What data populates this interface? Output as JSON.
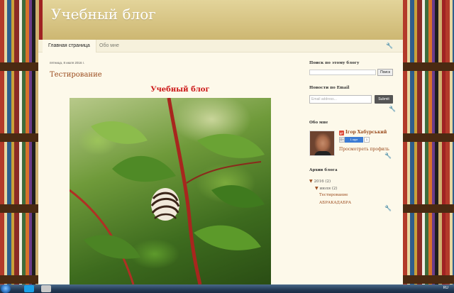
{
  "blog": {
    "title": "Учебный блог"
  },
  "tabs": {
    "home": "Главная страница",
    "about": "Обо мне"
  },
  "post": {
    "date": "пятница, 8 июля 2016 г.",
    "title": "Тестирование",
    "subtitle": "Учебный блог"
  },
  "sidebar": {
    "search": {
      "title": "Поиск по этому блогу",
      "button": "Поиск"
    },
    "email": {
      "title": "Новости по Email",
      "placeholder": "Email address...",
      "button": "Submit"
    },
    "about": {
      "title": "Обо мне",
      "name": "Ігор Хабурський",
      "follow_label": "1 круг",
      "follow_count": "1",
      "view_profile": "Просмотреть профиль"
    },
    "archive": {
      "title": "Архив блога",
      "year": "2016 (2)",
      "month": "июля (2)",
      "posts": [
        "Тестирование",
        "АБРАКАДАБРА"
      ]
    }
  },
  "taskbar": {
    "lang": "RU"
  },
  "colors": {
    "accent": "#9a4a1c",
    "header": "#cdb772",
    "red_title": "#cc1414"
  }
}
